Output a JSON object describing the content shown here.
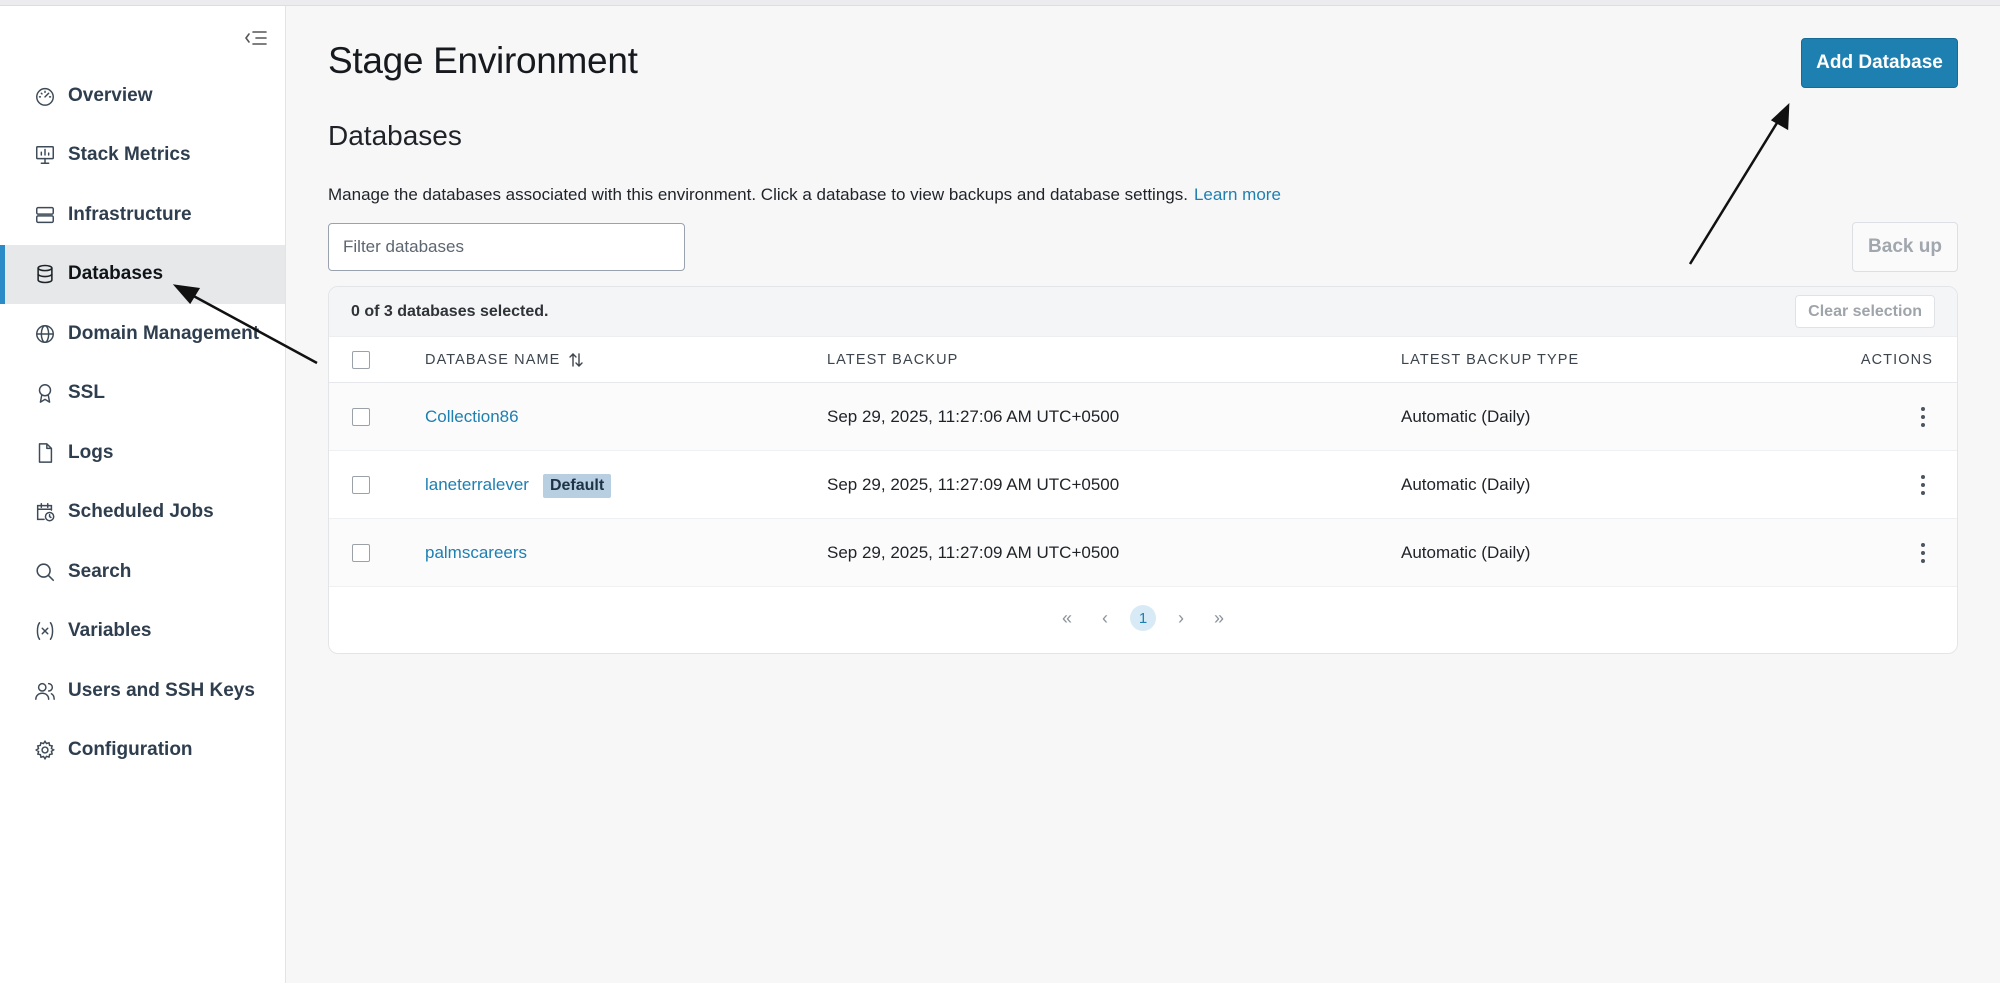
{
  "sidebar": {
    "items": [
      {
        "label": "Overview",
        "icon": "gauge-icon"
      },
      {
        "label": "Stack Metrics",
        "icon": "monitor-chart-icon"
      },
      {
        "label": "Infrastructure",
        "icon": "server-icon"
      },
      {
        "label": "Databases",
        "icon": "database-icon",
        "active": true
      },
      {
        "label": "Domain Management",
        "icon": "globe-icon"
      },
      {
        "label": "SSL",
        "icon": "award-icon"
      },
      {
        "label": "Logs",
        "icon": "file-icon"
      },
      {
        "label": "Scheduled Jobs",
        "icon": "calendar-clock-icon"
      },
      {
        "label": "Search",
        "icon": "search-icon"
      },
      {
        "label": "Variables",
        "icon": "variable-icon"
      },
      {
        "label": "Users and SSH Keys",
        "icon": "users-icon"
      },
      {
        "label": "Configuration",
        "icon": "gear-icon"
      }
    ]
  },
  "header": {
    "title": "Stage Environment",
    "add_button": "Add Database"
  },
  "section": {
    "title": "Databases",
    "description": "Manage the databases associated with this environment. Click a database to view backups and database settings.",
    "learn_more": "Learn more"
  },
  "filter": {
    "placeholder": "Filter databases"
  },
  "backup_button": "Back up",
  "table": {
    "selection_text": "0 of 3 databases selected.",
    "clear_selection": "Clear selection",
    "columns": [
      "DATABASE NAME",
      "LATEST BACKUP",
      "LATEST BACKUP TYPE",
      "ACTIONS"
    ],
    "rows": [
      {
        "name": "Collection86",
        "badge": "",
        "latest_backup": "Sep 29, 2025, 11:27:06 AM UTC+0500",
        "backup_type": "Automatic (Daily)"
      },
      {
        "name": "laneterralever",
        "badge": "Default",
        "latest_backup": "Sep 29, 2025, 11:27:09 AM UTC+0500",
        "backup_type": "Automatic (Daily)"
      },
      {
        "name": "palmscareers",
        "badge": "",
        "latest_backup": "Sep 29, 2025, 11:27:09 AM UTC+0500",
        "backup_type": "Automatic (Daily)"
      }
    ]
  },
  "pagination": {
    "first": "«",
    "prev": "‹",
    "current_page": "1",
    "next": "›",
    "last": "»"
  },
  "colors": {
    "accent": "#1e7fb1",
    "active_indicator": "#2b8bc7",
    "badge_bg": "#b7cfe0"
  }
}
